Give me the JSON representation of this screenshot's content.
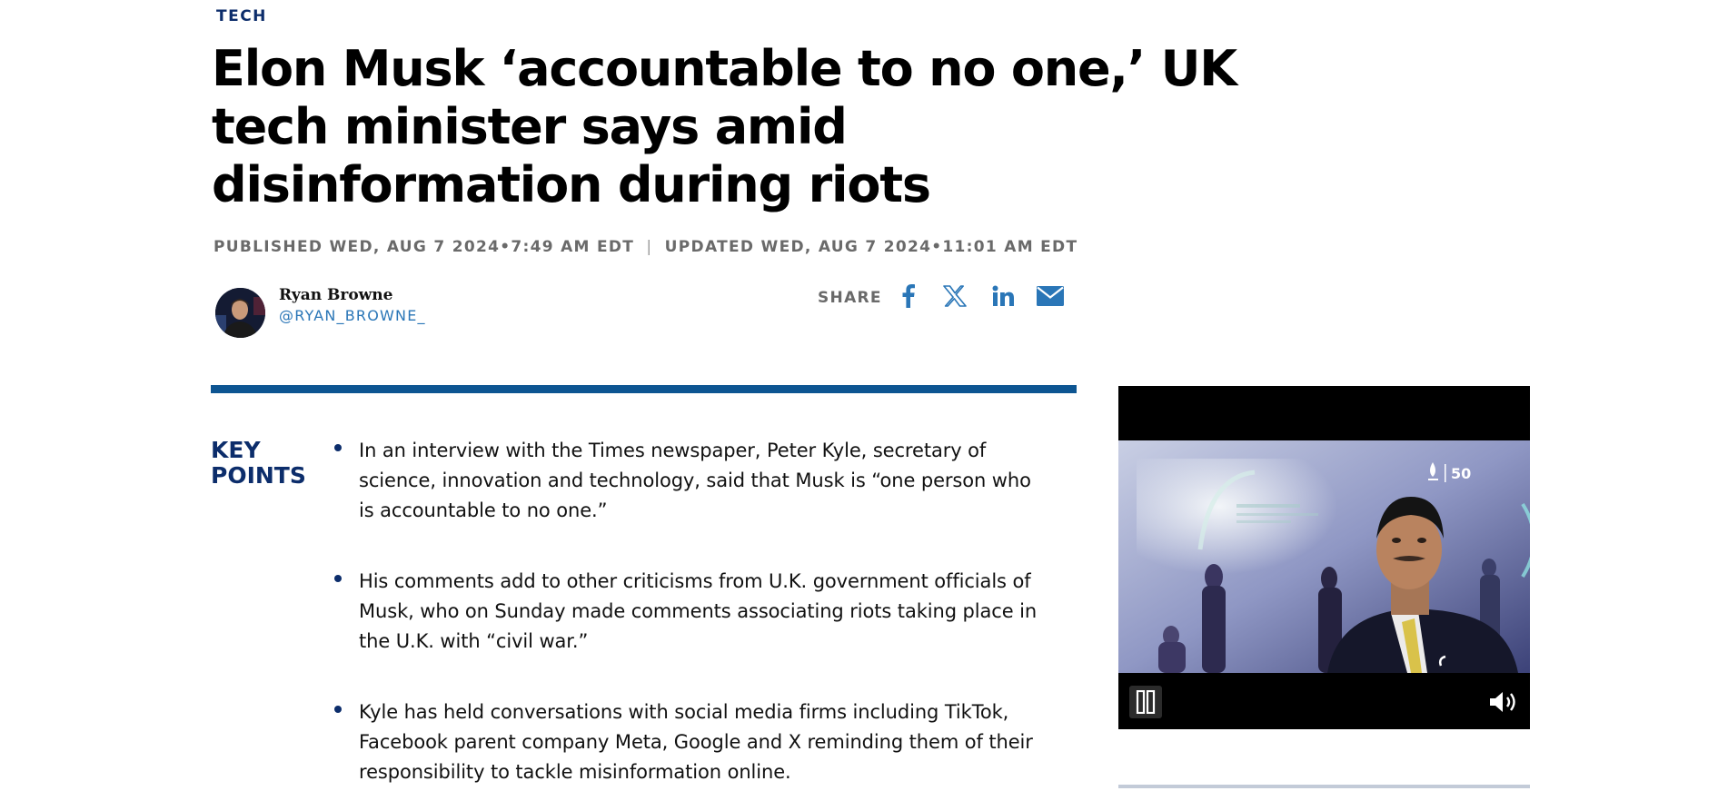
{
  "article": {
    "section": "TECH",
    "headline": "Elon Musk ‘accountable to no one,’ UK tech minister says amid disinformation during riots",
    "published": "PUBLISHED WED, AUG 7 2024•7:49 AM EDT",
    "separator": "|",
    "updated": "UPDATED WED, AUG 7 2024•11:01 AM EDT"
  },
  "author": {
    "name": "Ryan Browne",
    "handle": "@RYAN_BROWNE_"
  },
  "share": {
    "label": "SHARE",
    "icons": [
      "facebook-icon",
      "x-icon",
      "linkedin-icon",
      "email-icon"
    ]
  },
  "key_points": {
    "title_line1": "KEY",
    "title_line2": "POINTS",
    "items": [
      "In an interview with the Times newspaper, Peter Kyle, secretary of science, innovation and technology, said that Musk is “one person who is accountable to no one.”",
      "His comments add to other criticisms from U.K. government officials of Musk, who on Sunday made comments associating riots taking place in the U.K. with “civil war.”",
      "Kyle has held conversations with social media firms including TikTok, Facebook parent company Meta, Google and X reminding them of their responsibility to tackle misinformation online."
    ]
  },
  "video": {
    "overlay_logo_text": "50",
    "controls": [
      "pause-icon",
      "volume-icon"
    ]
  },
  "colors": {
    "navy": "#0c2d6b",
    "rule_blue": "#0d5592",
    "link_blue": "#2a76b7",
    "meta_gray": "#6a6a6a"
  }
}
